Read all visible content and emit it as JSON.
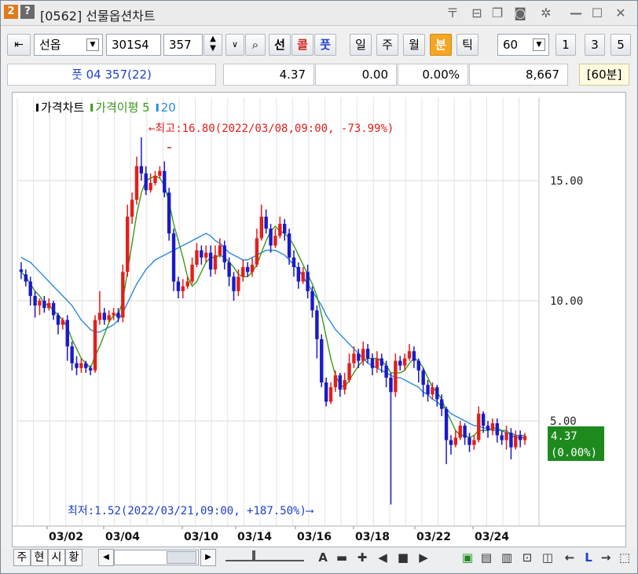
{
  "titlebar": {
    "badge_num": "2",
    "badge_help": "?",
    "title": "[0562] 선물옵션차트"
  },
  "toolbar": {
    "market_select": "선옵",
    "code_input": "301S4",
    "strike_input": "357",
    "btn_futures": "선",
    "btn_call": "콜",
    "btn_put": "풋",
    "period_day": "일",
    "period_week": "주",
    "period_month": "월",
    "period_minute": "분",
    "period_tick": "틱",
    "interval_select": "60",
    "quick_1": "1",
    "quick_3": "3",
    "quick_5": "5"
  },
  "inforow": {
    "instrument": "풋 04 357(22)",
    "price": "4.37",
    "change": "0.00",
    "change_pct": "0.00%",
    "volume": "8,667",
    "period_label": "[60분]"
  },
  "chart_data": {
    "type": "candlestick",
    "legend": [
      {
        "name": "가격차트",
        "color": "#000000"
      },
      {
        "name": "가격이평 5",
        "color": "#3a9a1a"
      },
      {
        "name": "20",
        "color": "#2a8ad8"
      }
    ],
    "y_ticks": [
      "15.00",
      "10.00",
      "5.00"
    ],
    "x_ticks": [
      "03/02",
      "03/04",
      "03/10",
      "03/14",
      "03/16",
      "03/18",
      "03/22",
      "03/24"
    ],
    "ylim": [
      0,
      20
    ],
    "high_annotation": "←최고:16.80(2022/03/08,09:00, -73.99%)",
    "low_annotation": "최저:1.52(2022/03/21,09:00, +187.50%)⟶",
    "current_price_label": "4.37",
    "current_change_label": "(0.00%)",
    "candles": [
      [
        11.3,
        11.2,
        11.6,
        10.9
      ],
      [
        11.1,
        10.8,
        11.3,
        10.6
      ],
      [
        10.8,
        10.2,
        11.0,
        9.8
      ],
      [
        10.2,
        9.8,
        10.4,
        9.3
      ],
      [
        9.8,
        10.0,
        10.1,
        9.4
      ],
      [
        10.0,
        9.7,
        10.2,
        9.5
      ],
      [
        9.7,
        9.9,
        10.1,
        9.6
      ],
      [
        9.9,
        9.4,
        10.0,
        9.2
      ],
      [
        9.4,
        9.0,
        9.5,
        8.6
      ],
      [
        9.0,
        9.2,
        9.3,
        8.8
      ],
      [
        9.2,
        8.1,
        9.4,
        7.5
      ],
      [
        8.1,
        7.4,
        8.3,
        7.1
      ],
      [
        7.4,
        7.2,
        7.7,
        6.9
      ],
      [
        7.2,
        7.4,
        7.6,
        7.0
      ],
      [
        7.4,
        7.2,
        7.5,
        7.0
      ],
      [
        7.2,
        7.1,
        7.3,
        6.9
      ],
      [
        7.1,
        9.2,
        9.4,
        7.0
      ],
      [
        9.2,
        9.5,
        10.4,
        9.0
      ],
      [
        9.5,
        9.2,
        9.7,
        9.0
      ],
      [
        9.2,
        9.4,
        9.6,
        9.1
      ],
      [
        9.4,
        9.5,
        9.7,
        9.2
      ],
      [
        9.5,
        9.3,
        9.7,
        9.1
      ],
      [
        9.3,
        11.2,
        11.5,
        9.1
      ],
      [
        11.2,
        13.5,
        14.0,
        11.0
      ],
      [
        13.5,
        14.2,
        14.5,
        13.2
      ],
      [
        14.2,
        15.6,
        16.0,
        14.0
      ],
      [
        15.6,
        15.3,
        16.8,
        15.0
      ],
      [
        15.3,
        14.6,
        15.6,
        14.4
      ],
      [
        14.6,
        14.9,
        15.3,
        14.5
      ],
      [
        14.9,
        15.2,
        15.4,
        14.8
      ],
      [
        15.2,
        15.4,
        15.6,
        15.1
      ],
      [
        15.4,
        14.5,
        15.8,
        14.3
      ],
      [
        14.5,
        12.8,
        14.7,
        12.5
      ],
      [
        12.8,
        10.8,
        13.0,
        10.4
      ],
      [
        10.8,
        10.4,
        11.0,
        10.1
      ],
      [
        10.4,
        10.6,
        10.9,
        10.1
      ],
      [
        10.6,
        10.8,
        11.0,
        10.5
      ],
      [
        10.8,
        11.5,
        11.8,
        10.7
      ],
      [
        11.5,
        12.1,
        12.4,
        11.4
      ],
      [
        12.1,
        11.8,
        12.3,
        11.5
      ],
      [
        11.8,
        12.0,
        12.3,
        11.6
      ],
      [
        12.0,
        11.3,
        12.3,
        11.0
      ],
      [
        11.3,
        11.9,
        12.3,
        11.1
      ],
      [
        11.9,
        12.3,
        12.6,
        11.8
      ],
      [
        12.3,
        11.6,
        12.5,
        11.3
      ],
      [
        11.6,
        11.0,
        11.8,
        10.6
      ],
      [
        11.0,
        10.4,
        11.2,
        10.0
      ],
      [
        10.4,
        11.0,
        11.3,
        10.2
      ],
      [
        11.0,
        11.4,
        11.7,
        10.8
      ],
      [
        11.4,
        11.2,
        11.6,
        11.0
      ],
      [
        11.2,
        11.5,
        11.8,
        11.0
      ],
      [
        11.5,
        12.6,
        13.0,
        11.4
      ],
      [
        12.6,
        13.5,
        14.0,
        12.5
      ],
      [
        13.5,
        13.0,
        13.8,
        12.8
      ],
      [
        13.0,
        12.3,
        13.2,
        12.0
      ],
      [
        12.3,
        12.7,
        13.0,
        12.2
      ],
      [
        12.7,
        13.2,
        13.5,
        12.6
      ],
      [
        13.2,
        12.8,
        13.4,
        12.5
      ],
      [
        12.8,
        11.8,
        13.0,
        11.5
      ],
      [
        11.8,
        11.4,
        12.1,
        11.0
      ],
      [
        11.4,
        10.8,
        11.6,
        10.5
      ],
      [
        10.8,
        11.2,
        11.4,
        10.7
      ],
      [
        11.2,
        10.4,
        11.5,
        10.1
      ],
      [
        10.4,
        9.6,
        10.6,
        9.3
      ],
      [
        9.6,
        8.4,
        9.8,
        7.6
      ],
      [
        8.4,
        6.6,
        8.6,
        6.4
      ],
      [
        6.6,
        5.8,
        6.8,
        5.6
      ],
      [
        5.8,
        6.4,
        6.6,
        5.7
      ],
      [
        6.4,
        6.9,
        7.1,
        6.2
      ],
      [
        6.9,
        6.3,
        7.0,
        6.0
      ],
      [
        6.3,
        6.7,
        7.0,
        6.1
      ],
      [
        6.7,
        7.4,
        7.8,
        6.6
      ],
      [
        7.4,
        7.8,
        8.1,
        7.2
      ],
      [
        7.8,
        7.5,
        8.0,
        7.2
      ],
      [
        7.5,
        8.0,
        8.3,
        7.3
      ],
      [
        8.0,
        7.6,
        8.2,
        7.4
      ],
      [
        7.6,
        7.2,
        7.8,
        6.9
      ],
      [
        7.2,
        7.6,
        7.9,
        7.0
      ],
      [
        7.6,
        7.3,
        7.8,
        7.0
      ],
      [
        7.3,
        6.8,
        7.5,
        6.4
      ],
      [
        6.8,
        6.2,
        7.0,
        1.52
      ],
      [
        6.2,
        7.5,
        7.8,
        6.0
      ],
      [
        7.5,
        7.3,
        7.7,
        7.1
      ],
      [
        7.3,
        7.6,
        7.8,
        7.1
      ],
      [
        7.6,
        7.9,
        8.2,
        7.5
      ],
      [
        7.9,
        7.5,
        8.1,
        7.2
      ],
      [
        7.5,
        7.1,
        7.6,
        6.6
      ],
      [
        7.1,
        6.5,
        7.2,
        6.0
      ],
      [
        6.5,
        6.1,
        6.7,
        5.8
      ],
      [
        6.1,
        6.4,
        6.6,
        5.9
      ],
      [
        6.4,
        5.9,
        6.5,
        5.6
      ],
      [
        5.9,
        5.5,
        6.1,
        5.2
      ],
      [
        5.5,
        4.2,
        5.6,
        3.2
      ],
      [
        4.2,
        4.0,
        4.4,
        3.6
      ],
      [
        4.0,
        4.3,
        4.6,
        3.9
      ],
      [
        4.3,
        4.8,
        5.0,
        4.2
      ],
      [
        4.8,
        4.3,
        4.9,
        4.0
      ],
      [
        4.3,
        4.0,
        4.5,
        3.7
      ],
      [
        4.0,
        4.2,
        4.4,
        3.8
      ],
      [
        4.2,
        5.3,
        5.6,
        4.1
      ],
      [
        5.3,
        4.8,
        5.4,
        4.5
      ],
      [
        4.8,
        4.6,
        5.0,
        4.3
      ],
      [
        4.6,
        4.9,
        5.1,
        4.4
      ],
      [
        4.9,
        4.4,
        5.1,
        4.1
      ],
      [
        4.4,
        4.2,
        4.6,
        4.0
      ],
      [
        4.2,
        4.5,
        4.8,
        3.8
      ],
      [
        4.5,
        3.9,
        4.7,
        3.4
      ],
      [
        3.9,
        4.4,
        4.6,
        3.8
      ],
      [
        4.4,
        4.2,
        4.6,
        3.9
      ],
      [
        4.2,
        4.37,
        4.5,
        4.0
      ]
    ],
    "ma5": [
      11.2,
      11.0,
      10.7,
      10.4,
      10.2,
      9.9,
      9.8,
      9.6,
      9.4,
      9.2,
      8.9,
      8.4,
      8.0,
      7.6,
      7.4,
      7.2,
      7.7,
      8.1,
      8.6,
      9.1,
      9.4,
      9.4,
      10.0,
      11.2,
      12.4,
      13.6,
      14.5,
      15.0,
      15.1,
      15.2,
      15.1,
      14.8,
      14.1,
      13.2,
      12.5,
      11.8,
      11.0,
      10.6,
      10.8,
      11.2,
      11.6,
      11.8,
      11.8,
      11.9,
      11.8,
      11.6,
      11.4,
      11.1,
      11.0,
      11.0,
      11.2,
      11.5,
      12.0,
      12.5,
      12.9,
      13.1,
      12.9,
      12.8,
      12.6,
      12.3,
      11.9,
      11.5,
      11.1,
      10.7,
      10.2,
      9.4,
      8.5,
      7.6,
      6.9,
      6.5,
      6.4,
      6.7,
      7.0,
      7.3,
      7.5,
      7.6,
      7.6,
      7.6,
      7.5,
      7.3,
      7.0,
      7.0,
      7.0,
      7.1,
      7.4,
      7.6,
      7.5,
      7.2,
      6.8,
      6.4,
      6.2,
      5.9,
      5.4,
      5.0,
      4.6,
      4.4,
      4.4,
      4.3,
      4.4,
      4.6,
      4.6,
      4.6,
      4.7,
      4.7,
      4.6,
      4.6,
      4.4,
      4.3,
      4.3,
      4.3
    ],
    "ma20": [
      11.8,
      11.7,
      11.6,
      11.4,
      11.2,
      11.0,
      10.8,
      10.6,
      10.4,
      10.2,
      10.0,
      9.8,
      9.5,
      9.2,
      9.0,
      8.8,
      8.7,
      8.7,
      8.8,
      8.9,
      9.0,
      9.2,
      9.5,
      9.9,
      10.3,
      10.7,
      11.0,
      11.3,
      11.5,
      11.7,
      11.8,
      11.9,
      12.0,
      12.1,
      12.2,
      12.3,
      12.4,
      12.5,
      12.6,
      12.7,
      12.8,
      12.7,
      12.5,
      12.4,
      12.2,
      12.0,
      11.9,
      11.8,
      11.7,
      11.7,
      11.8,
      11.9,
      12.0,
      12.1,
      12.1,
      12.1,
      12.0,
      11.9,
      11.7,
      11.5,
      11.3,
      11.0,
      10.7,
      10.4,
      10.1,
      9.8,
      9.4,
      9.1,
      8.8,
      8.6,
      8.4,
      8.2,
      8.0,
      7.8,
      7.6,
      7.4,
      7.3,
      7.2,
      7.1,
      7.0,
      6.9,
      6.8,
      6.8,
      6.7,
      6.6,
      6.5,
      6.4,
      6.2,
      6.1,
      5.9,
      5.8,
      5.6,
      5.5,
      5.3,
      5.2,
      5.1,
      5.0,
      4.9,
      4.8,
      4.8,
      4.7,
      4.7,
      4.6,
      4.6,
      4.6,
      4.5,
      4.5,
      4.4,
      4.4,
      4.4
    ]
  },
  "bottombar": {
    "tab_1": "주",
    "tab_2": "현",
    "tab_3": "시",
    "tab_4": "황",
    "text_tool": "A",
    "letter_l": "L"
  },
  "colors": {
    "up": "#e0201a",
    "down": "#1a1ac8",
    "ma5": "#3a9a1a",
    "ma20": "#2a8ad8",
    "price_box": "#1e8a1e",
    "minute_active": "#f5a623"
  }
}
